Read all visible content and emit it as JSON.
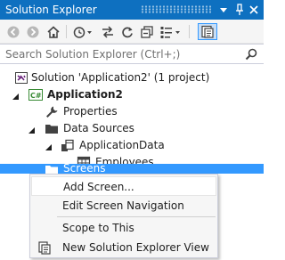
{
  "title_bar": {
    "title": "Solution Explorer",
    "controls": [
      "dropdown-icon",
      "pin-icon",
      "close-icon"
    ]
  },
  "toolbar": {
    "buttons": [
      "back-icon",
      "forward-icon",
      "home-icon",
      "history-icon",
      "sync-icon",
      "refresh-icon",
      "collapse-all-icon",
      "properties-icon",
      "preview-icon"
    ]
  },
  "search": {
    "placeholder": "Search Solution Explorer (Ctrl+;)"
  },
  "tree": {
    "items": [
      {
        "label": "Solution 'Application2' (1 project)",
        "icon": "solution-icon"
      },
      {
        "label": "Application2",
        "icon": "csharp-project-icon",
        "bold": true,
        "expanded": true
      },
      {
        "label": "Properties",
        "icon": "wrench-icon"
      },
      {
        "label": "Data Sources",
        "icon": "folder-icon",
        "expanded": true
      },
      {
        "label": "ApplicationData",
        "icon": "database-icon",
        "expanded": true
      },
      {
        "label": "Employees",
        "icon": "table-icon"
      },
      {
        "label": "Screens",
        "icon": "folder-icon",
        "selected": true
      }
    ]
  },
  "context_menu": {
    "items": [
      {
        "label": "Add Screen...",
        "hover": true
      },
      {
        "label": "Edit Screen Navigation"
      },
      {
        "label": "Scope to This"
      },
      {
        "label": "New Solution Explorer View",
        "icon": "new-view-icon"
      }
    ]
  },
  "colors": {
    "title_bar": "#0e70c0",
    "selection": "#3399ff",
    "toolbar_bg": "#f5f5f5",
    "menu_bg": "#f6f6f6"
  }
}
